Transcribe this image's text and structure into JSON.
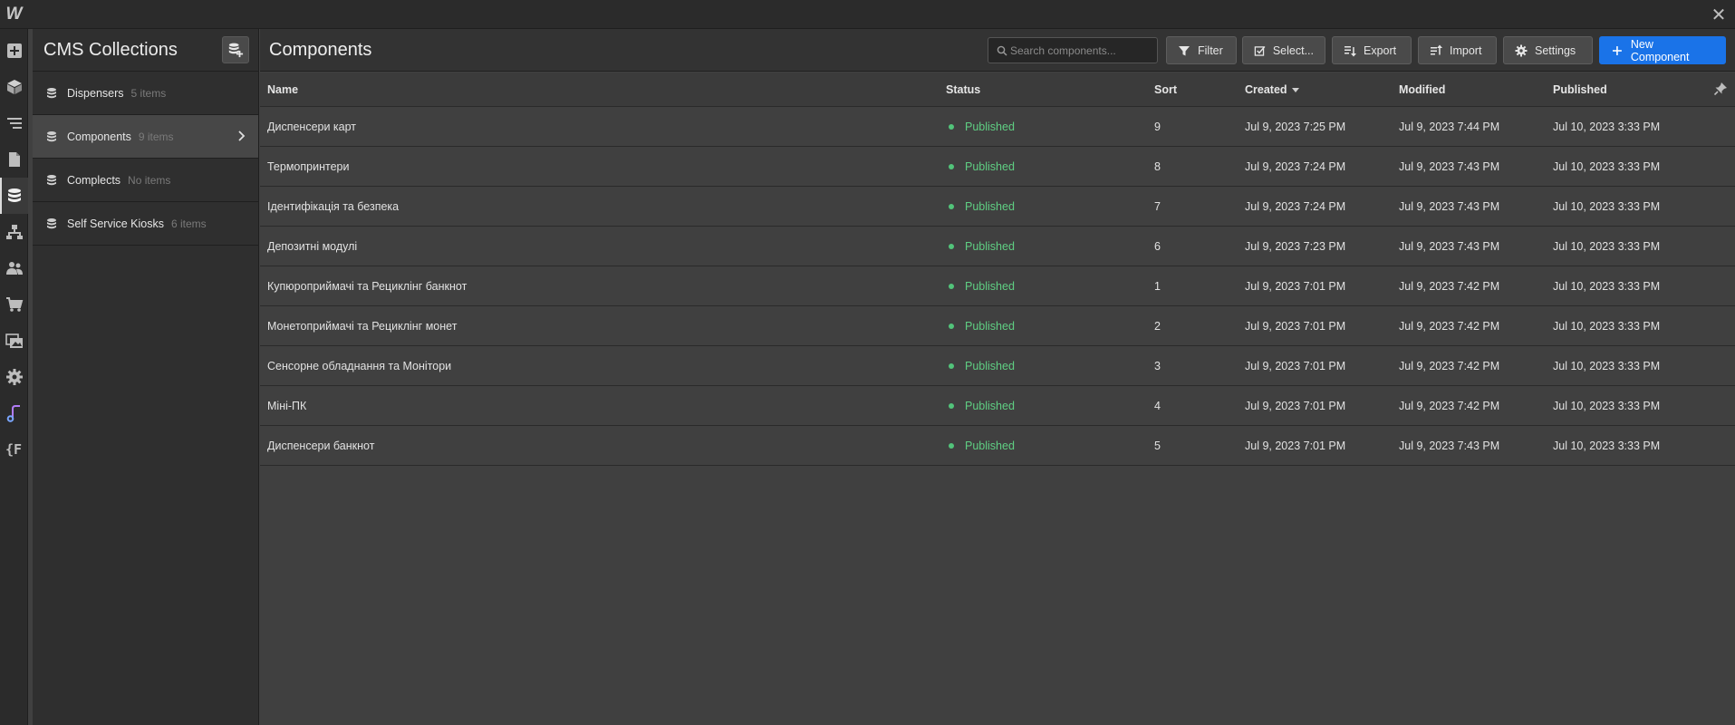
{
  "app": {
    "logo_text": "W",
    "close_glyph": "✕"
  },
  "rail": {
    "icons": [
      "add-icon",
      "cube-icon",
      "navigator-icon",
      "pages-icon",
      "cms-database-icon",
      "logic-flow-icon",
      "users-icon",
      "ecommerce-cart-icon",
      "assets-icon",
      "settings-gear-icon",
      "audio-app-icon",
      "finsweet-app-icon"
    ]
  },
  "collections": {
    "title": "CMS Collections",
    "items": [
      {
        "name": "Dispensers",
        "count": "5 items"
      },
      {
        "name": "Components",
        "count": "9 items"
      },
      {
        "name": "Complects",
        "count": "No items"
      },
      {
        "name": "Self Service Kiosks",
        "count": "6 items"
      }
    ],
    "active_index": 1
  },
  "main": {
    "title": "Components",
    "search_placeholder": "Search components...",
    "buttons": {
      "filter": "Filter",
      "select": "Select...",
      "export": "Export",
      "import": "Import",
      "settings": "Settings",
      "new": "New Component"
    }
  },
  "table": {
    "columns": {
      "name": "Name",
      "status": "Status",
      "sort": "Sort",
      "created": "Created",
      "modified": "Modified",
      "published": "Published"
    },
    "rows": [
      {
        "name": "Диспенсери карт",
        "status": "Published",
        "sort": "9",
        "created": "Jul 9, 2023 7:25 PM",
        "modified": "Jul 9, 2023 7:44 PM",
        "published": "Jul 10, 2023 3:33 PM"
      },
      {
        "name": "Термопринтери",
        "status": "Published",
        "sort": "8",
        "created": "Jul 9, 2023 7:24 PM",
        "modified": "Jul 9, 2023 7:43 PM",
        "published": "Jul 10, 2023 3:33 PM"
      },
      {
        "name": "Ідентифікація та безпека",
        "status": "Published",
        "sort": "7",
        "created": "Jul 9, 2023 7:24 PM",
        "modified": "Jul 9, 2023 7:43 PM",
        "published": "Jul 10, 2023 3:33 PM"
      },
      {
        "name": "Депозитні модулі",
        "status": "Published",
        "sort": "6",
        "created": "Jul 9, 2023 7:23 PM",
        "modified": "Jul 9, 2023 7:43 PM",
        "published": "Jul 10, 2023 3:33 PM"
      },
      {
        "name": "Купюроприймачі та Рециклінг банкнот",
        "status": "Published",
        "sort": "1",
        "created": "Jul 9, 2023 7:01 PM",
        "modified": "Jul 9, 2023 7:42 PM",
        "published": "Jul 10, 2023 3:33 PM"
      },
      {
        "name": "Монетоприймачі та Рециклінг монет",
        "status": "Published",
        "sort": "2",
        "created": "Jul 9, 2023 7:01 PM",
        "modified": "Jul 9, 2023 7:42 PM",
        "published": "Jul 10, 2023 3:33 PM"
      },
      {
        "name": "Сенсорне обладнання та Монітори",
        "status": "Published",
        "sort": "3",
        "created": "Jul 9, 2023 7:01 PM",
        "modified": "Jul 9, 2023 7:42 PM",
        "published": "Jul 10, 2023 3:33 PM"
      },
      {
        "name": "Міні-ПК",
        "status": "Published",
        "sort": "4",
        "created": "Jul 9, 2023 7:01 PM",
        "modified": "Jul 9, 2023 7:42 PM",
        "published": "Jul 10, 2023 3:33 PM"
      },
      {
        "name": "Диспенсери банкнот",
        "status": "Published",
        "sort": "5",
        "created": "Jul 9, 2023 7:01 PM",
        "modified": "Jul 9, 2023 7:43 PM",
        "published": "Jul 10, 2023 3:33 PM"
      }
    ]
  },
  "colors": {
    "accent": "#1a73e8",
    "status_published": "#5fcf83",
    "background": "#404040"
  }
}
